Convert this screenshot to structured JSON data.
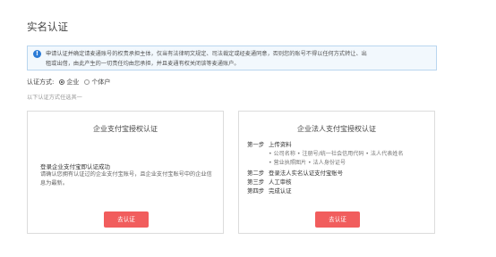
{
  "page_title": "实名认证",
  "notice": {
    "line1": "申请认证并确定请麦通账号的权责承担主体，仅当有法律明文规定、司法裁定或经麦通同意，否则您的账号不得以任何方式转让、出",
    "line2": "租或出借，由此产生的一切责任均由您承担，并且麦通有权关闭该等麦通账户。"
  },
  "auth_type": {
    "label": "认证方式:",
    "options": [
      {
        "label": "企业",
        "checked": true
      },
      {
        "label": "个体户",
        "checked": false
      }
    ]
  },
  "hint": "以下认证方式任选其一",
  "left_card": {
    "title": "企业支付宝授权认证",
    "desc_strong": "登录企业支付宝即认证成功",
    "desc": "请确认您拥有认证过的企业支付宝账号，且企业支付宝账号中的企业信息为最新。",
    "button": "去认证"
  },
  "right_card": {
    "title": "企业法人支付宝授权认证",
    "steps": [
      {
        "no": "第一步",
        "text": "上传资料"
      },
      {
        "no": "第二步",
        "text": "登录法人实名认证支付宝账号"
      },
      {
        "no": "第三步",
        "text": "人工审核"
      },
      {
        "no": "第四步",
        "text": "完成认证"
      }
    ],
    "sub_items": [
      "• 公司名称 • 注册号/统一社会信用代码 • 法人代表姓名",
      "• 营业执照图片 • 法人身份证号"
    ],
    "button": "去认证"
  },
  "colors": {
    "accent_button": "#f15d5d",
    "info_icon": "#2b7bd6",
    "notice_bg": "#f2f8fd"
  }
}
